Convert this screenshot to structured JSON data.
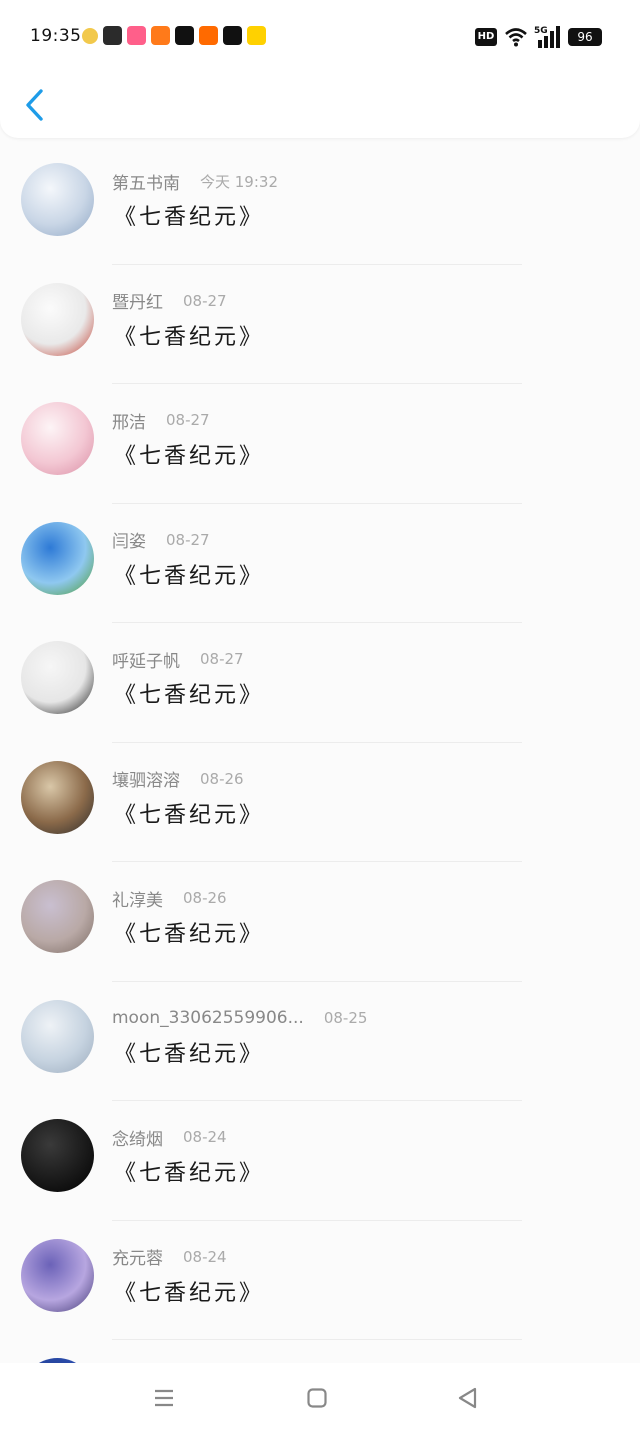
{
  "status_bar": {
    "time": "19:35",
    "hd_label": "HD",
    "network_label": "5G",
    "battery": "96",
    "app_icons": [
      {
        "icon": "notification-bell-icon",
        "color": "#f2c94c"
      },
      {
        "icon": "wechat-icon",
        "color": "#2b2b2b"
      },
      {
        "icon": "app-icon-pink",
        "color": "#ff5f8a"
      },
      {
        "icon": "app-icon-orange",
        "color": "#ff7a1a"
      },
      {
        "icon": "douyin-icon",
        "color": "#111111"
      },
      {
        "icon": "kuaishou-icon",
        "color": "#ff6a00"
      },
      {
        "icon": "video-app-icon",
        "color": "#111111"
      },
      {
        "icon": "meituan-icon",
        "color": "#ffd100"
      }
    ]
  },
  "header": {
    "back_icon": "chevron-left-icon",
    "accent": "#1e9ce8"
  },
  "items": [
    {
      "name": "第五书南",
      "date": "今天 19:32",
      "title": "《七香纪元》",
      "avatar_colors": [
        "#f4f7fb",
        "#c9d6e6",
        "#8ea6c4"
      ]
    },
    {
      "name": "暨丹红",
      "date": "08-27",
      "title": "《七香纪元》",
      "avatar_colors": [
        "#fbfbfb",
        "#e9e9e9",
        "#c0392b"
      ]
    },
    {
      "name": "邢洁",
      "date": "08-27",
      "title": "《七香纪元》",
      "avatar_colors": [
        "#fdf4f6",
        "#f3c7d3",
        "#d98ca3"
      ]
    },
    {
      "name": "闫姿",
      "date": "08-27",
      "title": "《七香纪元》",
      "avatar_colors": [
        "#2e7ad6",
        "#8fc8f0",
        "#4a9a2e"
      ]
    },
    {
      "name": "呼延子帆",
      "date": "08-27",
      "title": "《七香纪元》",
      "avatar_colors": [
        "#f6f6f6",
        "#e6e6e6",
        "#111111"
      ]
    },
    {
      "name": "壤驷溶溶",
      "date": "08-26",
      "title": "《七香纪元》",
      "avatar_colors": [
        "#d9c7a8",
        "#8b6a4a",
        "#2a2a2a"
      ]
    },
    {
      "name": "礼淳美",
      "date": "08-26",
      "title": "《七香纪元》",
      "avatar_colors": [
        "#c9bfd0",
        "#b9a9a6",
        "#7a6a62"
      ]
    },
    {
      "name": "moon_33062559906...",
      "date": "08-25",
      "title": "《七香纪元》",
      "avatar_colors": [
        "#eef2f6",
        "#c6d3e0",
        "#9aaabc"
      ]
    },
    {
      "name": "念绮烟",
      "date": "08-24",
      "title": "《七香纪元》",
      "avatar_colors": [
        "#3a3a3a",
        "#1a1a1a",
        "#000000"
      ]
    },
    {
      "name": "充元蓉",
      "date": "08-24",
      "title": "《七香纪元》",
      "avatar_colors": [
        "#6b62b8",
        "#b7a6e0",
        "#3d3470"
      ]
    },
    {
      "name": "",
      "date": "",
      "title": "",
      "avatar_colors": [
        "#1e3a8a",
        "#2d4fb0",
        "#0f1f55"
      ]
    }
  ],
  "navbar": {
    "menu_icon": "menu-lines-icon",
    "home_icon": "home-square-icon",
    "back_icon": "back-triangle-icon"
  }
}
